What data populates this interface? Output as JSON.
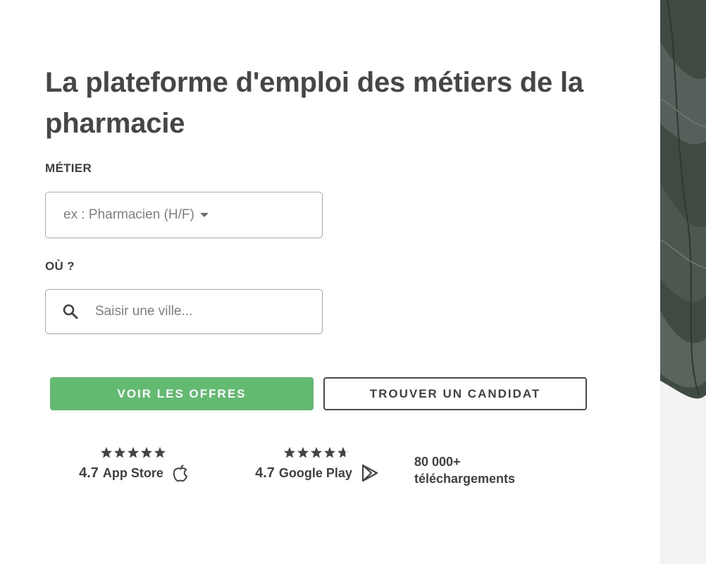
{
  "hero": {
    "title": "La plateforme d'emploi des métiers de la pharmacie"
  },
  "search": {
    "job_label": "MÉTIER",
    "job_placeholder": "ex : Pharmacien (H/F)",
    "city_label": "OÙ ?",
    "city_placeholder": "Saisir une ville..."
  },
  "actions": {
    "primary_label": "VOIR LES OFFRES",
    "secondary_label": "TROUVER UN CANDIDAT"
  },
  "ratings": [
    {
      "score": "4.7",
      "store": "App Store",
      "stars": 4.7,
      "icon": "apple-icon"
    },
    {
      "score": "4.7",
      "store": "Google Play",
      "stars": 4.7,
      "icon": "google-play-icon"
    }
  ],
  "downloads": {
    "count": "80 000+",
    "label": "téléchargements"
  },
  "colors": {
    "primary": "#62bb70",
    "text": "#414141"
  }
}
